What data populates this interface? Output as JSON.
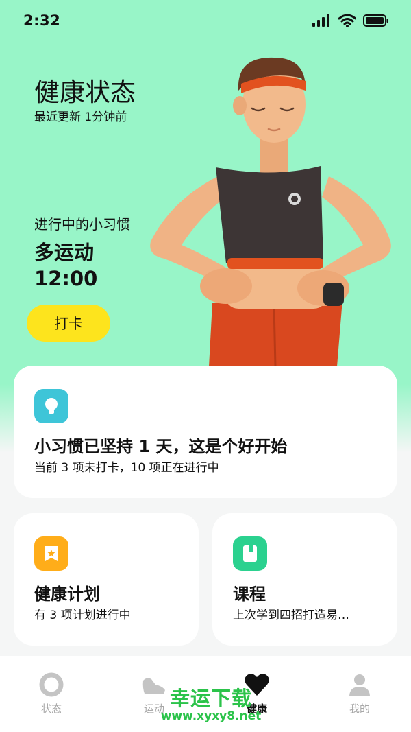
{
  "status_bar": {
    "time": "2:32"
  },
  "hero": {
    "title": "健康状态",
    "subtitle": "最近更新 1分钟前",
    "habit_label": "进行中的小习惯",
    "habit_name": "多运动",
    "habit_time": "12:00",
    "checkin_label": "打卡"
  },
  "cards": {
    "main": {
      "icon": "lightbulb-icon",
      "icon_color": "#3ec5d8",
      "title": "小习惯已坚持 1 天，这是个好开始",
      "desc": "当前 3 项未打卡，10 项正在进行中"
    },
    "plan": {
      "icon": "ribbon-star-icon",
      "icon_color": "#ffad19",
      "title": "健康计划",
      "desc": "有 3 项计划进行中"
    },
    "course": {
      "icon": "book-icon",
      "icon_color": "#2bd18f",
      "title": "课程",
      "desc": "上次学到四招打造易…"
    }
  },
  "tabs": [
    {
      "label": "状态",
      "icon": "ring-icon",
      "active": false
    },
    {
      "label": "运动",
      "icon": "shoe-icon",
      "active": false
    },
    {
      "label": "健康",
      "icon": "heart-icon",
      "active": true
    },
    {
      "label": "我的",
      "icon": "person-icon",
      "active": false
    }
  ],
  "watermark": {
    "name": "幸运下载",
    "url": "www.xyxy8.net"
  },
  "colors": {
    "hero_bg": "#98f5c8",
    "button": "#fde41d",
    "background": "#f5f6f6"
  }
}
